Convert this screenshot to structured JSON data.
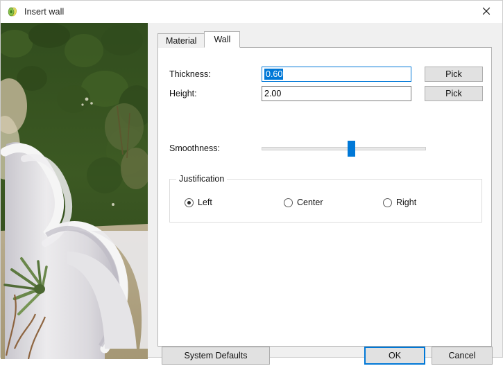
{
  "window": {
    "title": "Insert wall",
    "icon": "wall-coil-icon",
    "close_label": "×",
    "accent_color": "#0078d7",
    "button_face_color": "#e1e1e1",
    "dialog_background": "#f0f0f0"
  },
  "preview": {
    "name": "serpentine-wall-photo",
    "description": "Photograph of a white serpentine garden wall with green hedge and succulents"
  },
  "tabs": [
    {
      "label": "Material",
      "active": false
    },
    {
      "label": "Wall",
      "active": true
    }
  ],
  "form": {
    "thickness": {
      "label": "Thickness:",
      "value": "0.60",
      "selected": true,
      "focused": true,
      "pick_label": "Pick"
    },
    "height": {
      "label": "Height:",
      "value": "2.00",
      "selected": false,
      "focused": false,
      "pick_label": "Pick"
    },
    "smoothness": {
      "label": "Smoothness:",
      "value": 55,
      "min": 0,
      "max": 100
    },
    "justification": {
      "legend": "Justification",
      "options": [
        {
          "label": "Left",
          "checked": true
        },
        {
          "label": "Center",
          "checked": false
        },
        {
          "label": "Right",
          "checked": false
        }
      ]
    }
  },
  "footer": {
    "system_defaults_label": "System Defaults",
    "ok_label": "OK",
    "cancel_label": "Cancel"
  }
}
